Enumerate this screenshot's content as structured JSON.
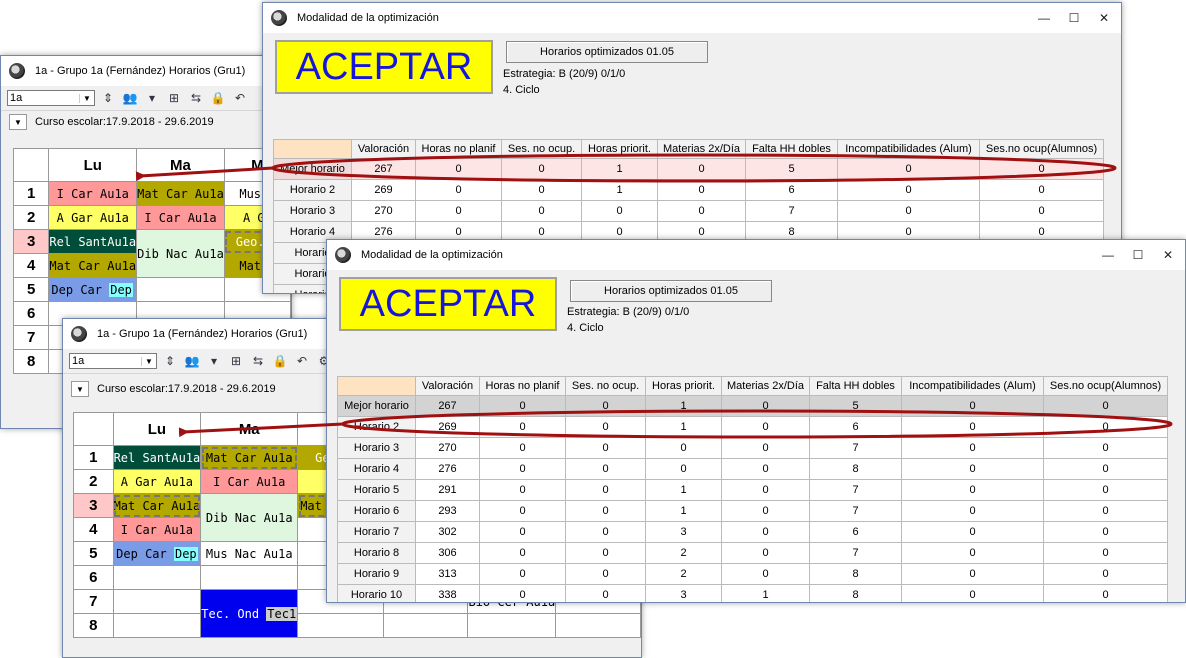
{
  "back_schedule": {
    "title": "1a - Grupo 1a (Fernández)  Horarios  (Gru1)",
    "combo_value": "1a",
    "term": "Curso escolar:17.9.2018 - 29.6.2019",
    "days": [
      "Lu",
      "Ma",
      "M"
    ],
    "row_numbers": [
      "1",
      "2",
      "3",
      "4",
      "5",
      "6",
      "7",
      "8"
    ],
    "cells": {
      "r1c1": "I  Car Au1a",
      "r1c2": "Mat Car Au1a",
      "r1c3": "Mus N",
      "r2c1": "A  Gar Au1a",
      "r2c2": "I  Car Au1a",
      "r2c3": "A  Ga",
      "r3c1": "Rel SantAu1a",
      "r34c2": "Dib Nac Au1a",
      "r3c3": "Geo. G",
      "r4c1": "Mat Car Au1a",
      "r4c3": "Mat C",
      "r5c1_text": "Dep Car ",
      "r5c1_tag": "Dep"
    }
  },
  "front_schedule": {
    "title": "1a - Grupo 1a (Fernández)  Horarios  (Gru1)",
    "combo_value": "1a",
    "term": "Curso escolar:17.9.2018 - 29.6.2019",
    "days": [
      "Lu",
      "Ma",
      "M"
    ],
    "row_numbers": [
      "1",
      "2",
      "3",
      "4",
      "5",
      "6",
      "7",
      "8"
    ],
    "cells": {
      "r1c1": "Rel SantAu1a",
      "r1c2": "Mat Car Au1a",
      "r1c3": "Geo. Go",
      "r2c1": "A  Gar Au1a",
      "r2c2": "I  Car Au1a",
      "r2c3": "A  Ga",
      "r3c1": "Mat Car Au1a",
      "r34c2": "Dib Nac Au1a",
      "r3c3": "Mat",
      "r4c1": "I  Car Au1a",
      "r5c1_text": "Dep Car ",
      "r5c1_tag": "Dep",
      "r5c2": "Mus Nac Au1a",
      "r78c2_text": "Tec. Ond ",
      "r78c2_tag": "Tec1",
      "r7c5": "Bio Cer Au1a"
    }
  },
  "dialog_back": {
    "title": "Modalidad de la optimización",
    "accept_label": "ACEPTAR",
    "heading": "Horarios optimizados 01.05",
    "strategy": "Estrategia: B (20/9)  0/1/0",
    "cycle": "4. Ciclo",
    "columns": [
      "Valoración",
      "Horas no planif",
      "Ses. no ocup.",
      "Horas priorit.",
      "Materias 2x/Día",
      "Falta HH dobles",
      "Incompatibilidades (Alum)",
      "Ses.no ocup(Alumnos)"
    ],
    "rows": [
      {
        "label": "Mejor horario",
        "values": [
          "267",
          "0",
          "0",
          "1",
          "0",
          "5",
          "0",
          "0"
        ]
      },
      {
        "label": "Horario 2",
        "values": [
          "269",
          "0",
          "0",
          "1",
          "0",
          "6",
          "0",
          "0"
        ]
      },
      {
        "label": "Horario 3",
        "values": [
          "270",
          "0",
          "0",
          "0",
          "0",
          "7",
          "0",
          "0"
        ]
      },
      {
        "label": "Horario 4",
        "values": [
          "276",
          "0",
          "0",
          "0",
          "0",
          "8",
          "0",
          "0"
        ]
      },
      {
        "label": "Horario",
        "values": [
          "",
          "",
          "",
          "",
          "",
          "",
          "",
          ""
        ]
      },
      {
        "label": "Horario",
        "values": [
          "",
          "",
          "",
          "",
          "",
          "",
          "",
          ""
        ]
      },
      {
        "label": "Horario",
        "values": [
          "",
          "",
          "",
          "",
          "",
          "",
          "",
          ""
        ]
      },
      {
        "label": "Horario",
        "values": [
          "",
          "",
          "",
          "",
          "",
          "",
          "",
          ""
        ]
      }
    ]
  },
  "dialog_front": {
    "title": "Modalidad de la optimización",
    "accept_label": "ACEPTAR",
    "heading": "Horarios optimizados 01.05",
    "strategy": "Estrategia: B (20/9)  0/1/0",
    "cycle": "4. Ciclo",
    "columns": [
      "Valoración",
      "Horas no planif",
      "Ses. no ocup.",
      "Horas priorit.",
      "Materias 2x/Día",
      "Falta HH dobles",
      "Incompatibilidades (Alum)",
      "Ses.no ocup(Alumnos)"
    ],
    "rows": [
      {
        "label": "Mejor horario",
        "values": [
          "267",
          "0",
          "0",
          "1",
          "0",
          "5",
          "0",
          "0"
        ]
      },
      {
        "label": "Horario 2",
        "values": [
          "269",
          "0",
          "0",
          "1",
          "0",
          "6",
          "0",
          "0"
        ]
      },
      {
        "label": "Horario 3",
        "values": [
          "270",
          "0",
          "0",
          "0",
          "0",
          "7",
          "0",
          "0"
        ]
      },
      {
        "label": "Horario 4",
        "values": [
          "276",
          "0",
          "0",
          "0",
          "0",
          "8",
          "0",
          "0"
        ]
      },
      {
        "label": "Horario 5",
        "values": [
          "291",
          "0",
          "0",
          "1",
          "0",
          "7",
          "0",
          "0"
        ]
      },
      {
        "label": "Horario 6",
        "values": [
          "293",
          "0",
          "0",
          "1",
          "0",
          "7",
          "0",
          "0"
        ]
      },
      {
        "label": "Horario 7",
        "values": [
          "302",
          "0",
          "0",
          "3",
          "0",
          "6",
          "0",
          "0"
        ]
      },
      {
        "label": "Horario 8",
        "values": [
          "306",
          "0",
          "0",
          "2",
          "0",
          "7",
          "0",
          "0"
        ]
      },
      {
        "label": "Horario 9",
        "values": [
          "313",
          "0",
          "0",
          "2",
          "0",
          "8",
          "0",
          "0"
        ]
      },
      {
        "label": "Horario 10",
        "values": [
          "338",
          "0",
          "0",
          "3",
          "1",
          "8",
          "0",
          "0"
        ]
      }
    ]
  },
  "colors": {
    "highlight_ellipse": "#a01010",
    "aceptar_bg": "#ffff00",
    "aceptar_text": "#1515dd",
    "selected_row": "#d3d3d3"
  }
}
